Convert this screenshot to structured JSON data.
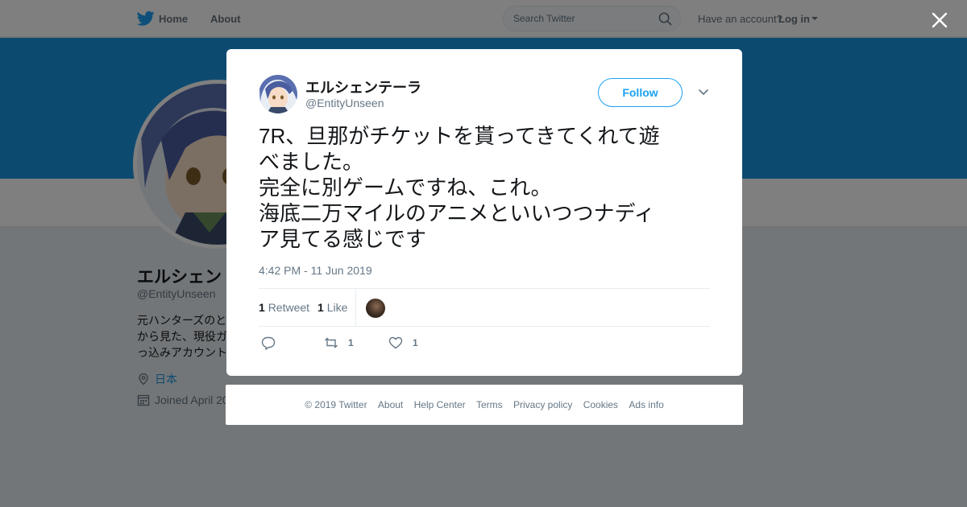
{
  "topbar": {
    "home_label": "Home",
    "about_label": "About",
    "search_placeholder": "Search Twitter",
    "account_question": "Have an account?",
    "login_label": "Log in"
  },
  "profile": {
    "name": "エルシェン",
    "handle": "@EntityUnseen",
    "bio_lines": [
      "元ハンターズのと",
      "から見た、現役ガ",
      "っ込みアカウント"
    ],
    "location": "日本",
    "joined": "Joined April 20"
  },
  "tweet": {
    "author_name": "エルシェンテーラ",
    "author_handle": "@EntityUnseen",
    "follow_label": "Follow",
    "text_lines": [
      "7R、旦那がチケットを貰ってきてくれて遊",
      "べました。",
      "完全に別ゲームですね、これ。",
      "海底二万マイルのアニメといいつつナディ",
      "ア見てる感じです"
    ],
    "timestamp": "4:42 PM - 11 Jun 2019",
    "retweet_count": "1",
    "retweet_label": "Retweet",
    "like_count": "1",
    "like_label": "Like",
    "action_retweet_count": "1",
    "action_like_count": "1"
  },
  "footer": {
    "links": [
      "© 2019 Twitter",
      "About",
      "Help Center",
      "Terms",
      "Privacy policy",
      "Cookies",
      "Ads info"
    ]
  },
  "colors": {
    "twitter_blue": "#1da1f2",
    "banner_blue": "#1b95e0",
    "overlay": "rgba(0,0,0,0.5)"
  },
  "icons": [
    "twitter-bird-icon",
    "search-icon",
    "caret-down-icon",
    "location-pin-icon",
    "calendar-icon",
    "close-icon",
    "chevron-down-icon",
    "reply-icon",
    "retweet-icon",
    "heart-icon"
  ]
}
